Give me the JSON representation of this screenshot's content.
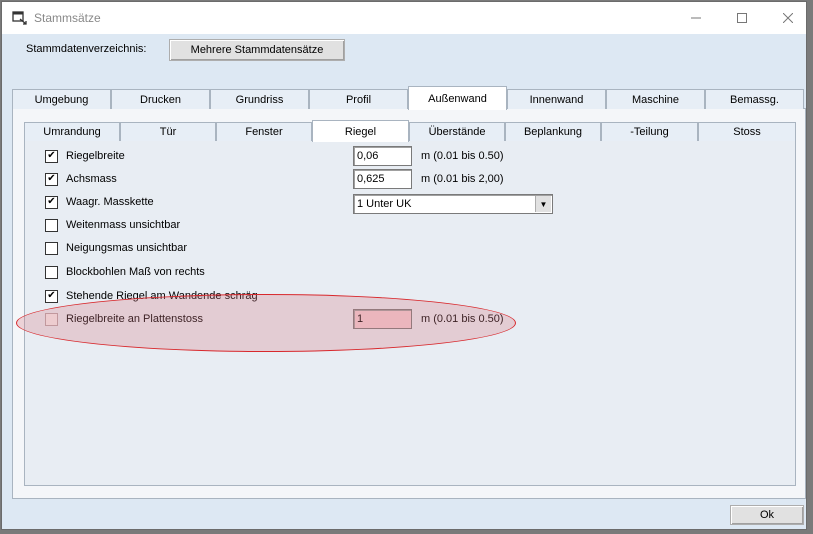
{
  "window": {
    "title": "Stammsätze"
  },
  "header": {
    "dir_label": "Stammdatenverzeichnis:",
    "mehrere_button": "Mehrere Stammdatensätze"
  },
  "tabs_main": [
    "Umgebung",
    "Drucken",
    "Grundriss",
    "Profil",
    "Außenwand",
    "Innenwand",
    "Maschine",
    "Bemassg."
  ],
  "tabs_main_active": "Außenwand",
  "tabs_sub": [
    "Umrandung",
    "Tür",
    "Fenster",
    "Riegel",
    "Überstände",
    "Beplankung",
    "-Teilung",
    "Stoss"
  ],
  "tabs_sub_active": "Riegel",
  "options": [
    {
      "label": "Riegelbreite",
      "checked": true,
      "value": "0,06",
      "unit": "m (0.01 bis 0.50)"
    },
    {
      "label": "Achsmass",
      "checked": true,
      "value": "0,625",
      "unit": "m (0.01 bis 2,00)"
    },
    {
      "label": "Waagr. Masskette",
      "checked": true,
      "select": "1  Unter UK"
    },
    {
      "label": "Weitenmass unsichtbar",
      "checked": false
    },
    {
      "label": "Neigungsmas unsichtbar",
      "checked": false
    },
    {
      "label": "Blockbohlen Maß von rechts",
      "checked": false
    },
    {
      "label": "Stehende Riegel am Wandende schräg",
      "checked": true
    },
    {
      "label": "Riegelbreite an Plattenstoss",
      "checked": false,
      "value": "1",
      "unit": "m (0.01 bis 0.50)"
    }
  ],
  "footer": {
    "ok_label": "Ok"
  },
  "colors": {
    "window_bg": "#dde8f3",
    "highlight": "#d8282c",
    "pink_field": "#f3cfd4"
  }
}
